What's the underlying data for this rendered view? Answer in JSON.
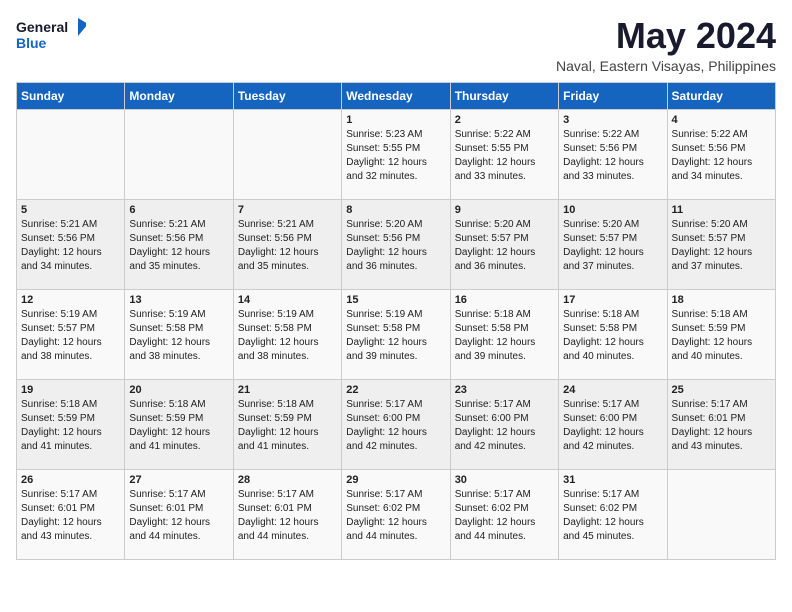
{
  "logo": {
    "general": "General",
    "blue": "Blue"
  },
  "title": "May 2024",
  "subtitle": "Naval, Eastern Visayas, Philippines",
  "days_header": [
    "Sunday",
    "Monday",
    "Tuesday",
    "Wednesday",
    "Thursday",
    "Friday",
    "Saturday"
  ],
  "weeks": [
    [
      {
        "day": "",
        "sunrise": "",
        "sunset": "",
        "daylight": ""
      },
      {
        "day": "",
        "sunrise": "",
        "sunset": "",
        "daylight": ""
      },
      {
        "day": "",
        "sunrise": "",
        "sunset": "",
        "daylight": ""
      },
      {
        "day": "1",
        "sunrise": "Sunrise: 5:23 AM",
        "sunset": "Sunset: 5:55 PM",
        "daylight": "Daylight: 12 hours and 32 minutes."
      },
      {
        "day": "2",
        "sunrise": "Sunrise: 5:22 AM",
        "sunset": "Sunset: 5:55 PM",
        "daylight": "Daylight: 12 hours and 33 minutes."
      },
      {
        "day": "3",
        "sunrise": "Sunrise: 5:22 AM",
        "sunset": "Sunset: 5:56 PM",
        "daylight": "Daylight: 12 hours and 33 minutes."
      },
      {
        "day": "4",
        "sunrise": "Sunrise: 5:22 AM",
        "sunset": "Sunset: 5:56 PM",
        "daylight": "Daylight: 12 hours and 34 minutes."
      }
    ],
    [
      {
        "day": "5",
        "sunrise": "Sunrise: 5:21 AM",
        "sunset": "Sunset: 5:56 PM",
        "daylight": "Daylight: 12 hours and 34 minutes."
      },
      {
        "day": "6",
        "sunrise": "Sunrise: 5:21 AM",
        "sunset": "Sunset: 5:56 PM",
        "daylight": "Daylight: 12 hours and 35 minutes."
      },
      {
        "day": "7",
        "sunrise": "Sunrise: 5:21 AM",
        "sunset": "Sunset: 5:56 PM",
        "daylight": "Daylight: 12 hours and 35 minutes."
      },
      {
        "day": "8",
        "sunrise": "Sunrise: 5:20 AM",
        "sunset": "Sunset: 5:56 PM",
        "daylight": "Daylight: 12 hours and 36 minutes."
      },
      {
        "day": "9",
        "sunrise": "Sunrise: 5:20 AM",
        "sunset": "Sunset: 5:57 PM",
        "daylight": "Daylight: 12 hours and 36 minutes."
      },
      {
        "day": "10",
        "sunrise": "Sunrise: 5:20 AM",
        "sunset": "Sunset: 5:57 PM",
        "daylight": "Daylight: 12 hours and 37 minutes."
      },
      {
        "day": "11",
        "sunrise": "Sunrise: 5:20 AM",
        "sunset": "Sunset: 5:57 PM",
        "daylight": "Daylight: 12 hours and 37 minutes."
      }
    ],
    [
      {
        "day": "12",
        "sunrise": "Sunrise: 5:19 AM",
        "sunset": "Sunset: 5:57 PM",
        "daylight": "Daylight: 12 hours and 38 minutes."
      },
      {
        "day": "13",
        "sunrise": "Sunrise: 5:19 AM",
        "sunset": "Sunset: 5:58 PM",
        "daylight": "Daylight: 12 hours and 38 minutes."
      },
      {
        "day": "14",
        "sunrise": "Sunrise: 5:19 AM",
        "sunset": "Sunset: 5:58 PM",
        "daylight": "Daylight: 12 hours and 38 minutes."
      },
      {
        "day": "15",
        "sunrise": "Sunrise: 5:19 AM",
        "sunset": "Sunset: 5:58 PM",
        "daylight": "Daylight: 12 hours and 39 minutes."
      },
      {
        "day": "16",
        "sunrise": "Sunrise: 5:18 AM",
        "sunset": "Sunset: 5:58 PM",
        "daylight": "Daylight: 12 hours and 39 minutes."
      },
      {
        "day": "17",
        "sunrise": "Sunrise: 5:18 AM",
        "sunset": "Sunset: 5:58 PM",
        "daylight": "Daylight: 12 hours and 40 minutes."
      },
      {
        "day": "18",
        "sunrise": "Sunrise: 5:18 AM",
        "sunset": "Sunset: 5:59 PM",
        "daylight": "Daylight: 12 hours and 40 minutes."
      }
    ],
    [
      {
        "day": "19",
        "sunrise": "Sunrise: 5:18 AM",
        "sunset": "Sunset: 5:59 PM",
        "daylight": "Daylight: 12 hours and 41 minutes."
      },
      {
        "day": "20",
        "sunrise": "Sunrise: 5:18 AM",
        "sunset": "Sunset: 5:59 PM",
        "daylight": "Daylight: 12 hours and 41 minutes."
      },
      {
        "day": "21",
        "sunrise": "Sunrise: 5:18 AM",
        "sunset": "Sunset: 5:59 PM",
        "daylight": "Daylight: 12 hours and 41 minutes."
      },
      {
        "day": "22",
        "sunrise": "Sunrise: 5:17 AM",
        "sunset": "Sunset: 6:00 PM",
        "daylight": "Daylight: 12 hours and 42 minutes."
      },
      {
        "day": "23",
        "sunrise": "Sunrise: 5:17 AM",
        "sunset": "Sunset: 6:00 PM",
        "daylight": "Daylight: 12 hours and 42 minutes."
      },
      {
        "day": "24",
        "sunrise": "Sunrise: 5:17 AM",
        "sunset": "Sunset: 6:00 PM",
        "daylight": "Daylight: 12 hours and 42 minutes."
      },
      {
        "day": "25",
        "sunrise": "Sunrise: 5:17 AM",
        "sunset": "Sunset: 6:01 PM",
        "daylight": "Daylight: 12 hours and 43 minutes."
      }
    ],
    [
      {
        "day": "26",
        "sunrise": "Sunrise: 5:17 AM",
        "sunset": "Sunset: 6:01 PM",
        "daylight": "Daylight: 12 hours and 43 minutes."
      },
      {
        "day": "27",
        "sunrise": "Sunrise: 5:17 AM",
        "sunset": "Sunset: 6:01 PM",
        "daylight": "Daylight: 12 hours and 44 minutes."
      },
      {
        "day": "28",
        "sunrise": "Sunrise: 5:17 AM",
        "sunset": "Sunset: 6:01 PM",
        "daylight": "Daylight: 12 hours and 44 minutes."
      },
      {
        "day": "29",
        "sunrise": "Sunrise: 5:17 AM",
        "sunset": "Sunset: 6:02 PM",
        "daylight": "Daylight: 12 hours and 44 minutes."
      },
      {
        "day": "30",
        "sunrise": "Sunrise: 5:17 AM",
        "sunset": "Sunset: 6:02 PM",
        "daylight": "Daylight: 12 hours and 44 minutes."
      },
      {
        "day": "31",
        "sunrise": "Sunrise: 5:17 AM",
        "sunset": "Sunset: 6:02 PM",
        "daylight": "Daylight: 12 hours and 45 minutes."
      },
      {
        "day": "",
        "sunrise": "",
        "sunset": "",
        "daylight": ""
      }
    ]
  ]
}
